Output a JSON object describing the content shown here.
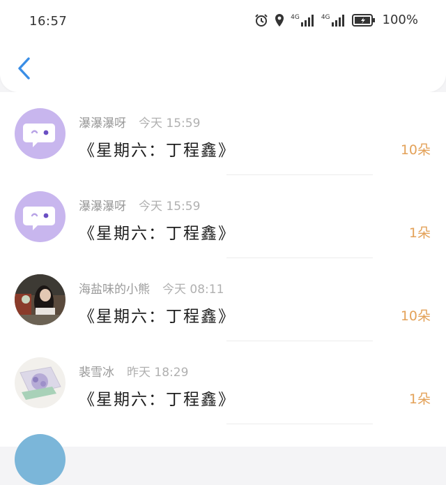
{
  "status_bar": {
    "time": "16:57",
    "network_1": "4G",
    "network_2": "4G",
    "battery_percent": "100%"
  },
  "header": {
    "back_icon": "chevron-left-icon",
    "accent_color": "#3a8ee6"
  },
  "items": [
    {
      "name": "瀑瀑瀑呀",
      "timestamp": "今天 15:59",
      "message": "《星期六：丁程鑫》",
      "count": "10朵",
      "avatar": "chat-bubble-avatar"
    },
    {
      "name": "瀑瀑瀑呀",
      "timestamp": "今天 15:59",
      "message": "《星期六：丁程鑫》",
      "count": "1朵",
      "avatar": "chat-bubble-avatar"
    },
    {
      "name": "海盐味的小熊",
      "timestamp": "今天 08:11",
      "message": "《星期六：丁程鑫》",
      "count": "10朵",
      "avatar": "photo-avatar"
    },
    {
      "name": "裴雪冰",
      "timestamp": "昨天 18:29",
      "message": "《星期六：丁程鑫》",
      "count": "1朵",
      "avatar": "photo-avatar"
    }
  ],
  "colors": {
    "count": "#e3a158",
    "avatar_purple": "#c8b6ee"
  }
}
